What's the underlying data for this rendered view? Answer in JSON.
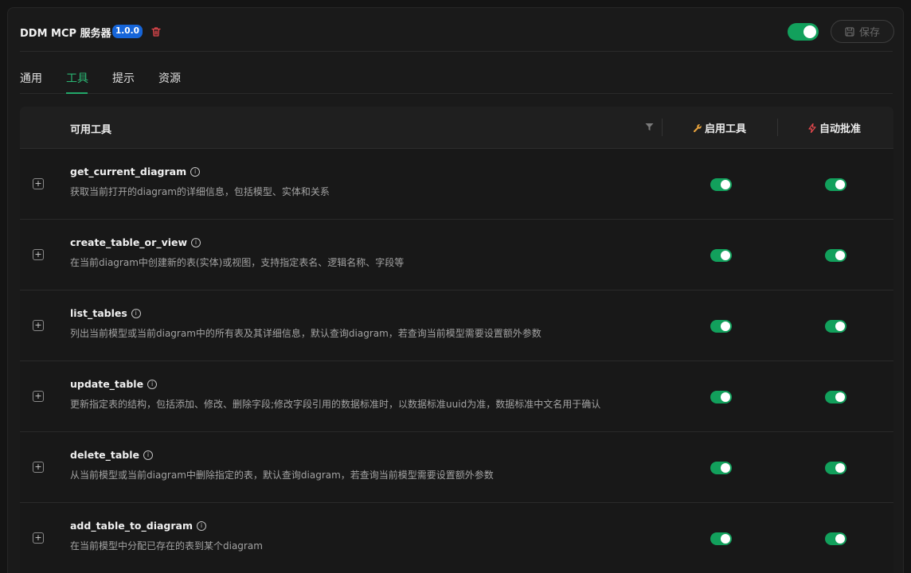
{
  "header": {
    "title": "DDM MCP 服务器",
    "version": "1.0.0",
    "save_label": "保存"
  },
  "tabs": [
    {
      "label": "通用"
    },
    {
      "label": "工具"
    },
    {
      "label": "提示"
    },
    {
      "label": "资源"
    }
  ],
  "table": {
    "col_tools": "可用工具",
    "col_enable": "启用工具",
    "col_auto": "自动批准",
    "rows": [
      {
        "name": "get_current_diagram",
        "desc": "获取当前打开的diagram的详细信息，包括模型、实体和关系",
        "enabled": true,
        "auto": true
      },
      {
        "name": "create_table_or_view",
        "desc": "在当前diagram中创建新的表(实体)或视图，支持指定表名、逻辑名称、字段等",
        "enabled": true,
        "auto": true
      },
      {
        "name": "list_tables",
        "desc": "列出当前模型或当前diagram中的所有表及其详细信息，默认查询diagram，若查询当前模型需要设置额外参数",
        "enabled": true,
        "auto": true
      },
      {
        "name": "update_table",
        "desc": "更新指定表的结构，包括添加、修改、删除字段;修改字段引用的数据标准时，以数据标准uuid为准，数据标准中文名用于确认",
        "enabled": true,
        "auto": true
      },
      {
        "name": "delete_table",
        "desc": "从当前模型或当前diagram中删除指定的表，默认查询diagram，若查询当前模型需要设置额外参数",
        "enabled": true,
        "auto": true
      },
      {
        "name": "add_table_to_diagram",
        "desc": "在当前模型中分配已存在的表到某个diagram",
        "enabled": true,
        "auto": true
      }
    ]
  },
  "colors": {
    "accent": "#12a05c",
    "version_badge": "#1665d8",
    "danger": "#e5484d",
    "wrench": "#e8a33d"
  }
}
